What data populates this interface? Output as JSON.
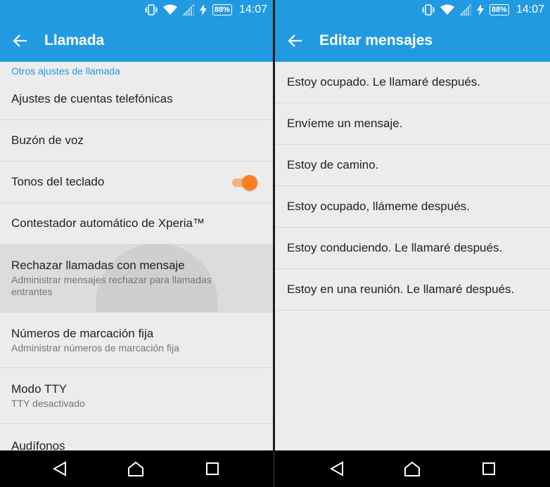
{
  "status": {
    "battery": "88%",
    "time": "14:07"
  },
  "left": {
    "title": "Llamada",
    "section": "Otros ajustes de llamada",
    "items": [
      {
        "primary": "Ajustes de cuentas telefónicas"
      },
      {
        "primary": "Buzón de voz"
      },
      {
        "primary": "Tonos del teclado",
        "toggle_on": true
      },
      {
        "primary": "Contestador automático de Xperia™"
      },
      {
        "primary": "Rechazar llamadas con mensaje",
        "secondary": "Administrar mensajes rechazar para llamadas entrantes"
      },
      {
        "primary": "Números de marcación fija",
        "secondary": "Administrar números de marcación fija"
      },
      {
        "primary": "Modo TTY",
        "secondary": "TTY desactivado"
      },
      {
        "primary": "Audífonos"
      }
    ]
  },
  "right": {
    "title": "Editar mensajes",
    "messages": [
      "Estoy ocupado. Le llamaré después.",
      "Envíeme un mensaje.",
      "Estoy de camino.",
      "Estoy ocupado, llámeme después.",
      "Estoy conduciendo. Le llamaré después.",
      "Estoy en una reunión. Le llamaré después."
    ]
  },
  "colors": {
    "accent": "#229ae2",
    "toggle": "#ff7f1e",
    "background": "#ececec"
  },
  "icons": {
    "back": "arrow-left-icon",
    "vibrate": "vibrate-icon",
    "wifi": "wifi-icon",
    "signal": "signal-icon",
    "charging": "charging-icon",
    "nav_back": "triangle-back-icon",
    "nav_home": "circle-home-icon",
    "nav_recent": "square-recent-icon"
  }
}
